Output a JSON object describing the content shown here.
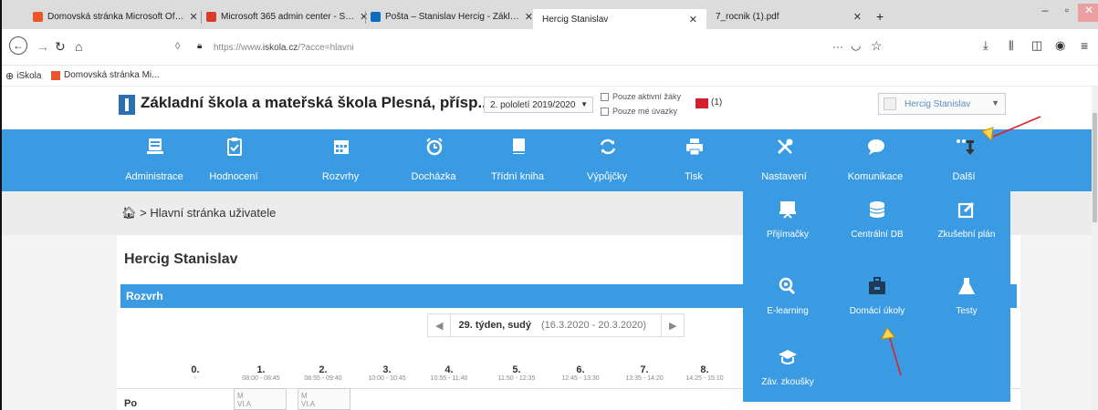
{
  "browser": {
    "tabs": [
      {
        "label": "Domovská stránka Microsoft Of…",
        "close": "✕",
        "color": "#e8562a"
      },
      {
        "label": "Microsoft 365 admin center - S…",
        "close": "✕",
        "color": "#d73b2a"
      },
      {
        "label": "Pošta – Stanislav Hercig - Zákl…",
        "close": "✕",
        "color": "#0f6cbd"
      },
      {
        "label": "Hercig Stanislav",
        "close": "✕",
        "color": "#ffffff"
      },
      {
        "label": "7_rocnik (1).pdf",
        "close": "✕",
        "color": "#dcdcdc"
      }
    ],
    "new_tab": "+",
    "url_prefix": "https://www.",
    "url_domain": "iskola.cz",
    "url_rest": "/?acce=hlavni",
    "page_actions": "···",
    "bookmarks": [
      {
        "label": "iSkola"
      },
      {
        "label": "Domovská stránka Mi..."
      }
    ]
  },
  "app": {
    "school_name": "Základní škola a mateřská škola Plesná, přísp...",
    "period": "2. pololetí 2019/2020",
    "filter_active": "Pouze aktivní žáky",
    "filter_mine": "Pouze mé úvazky",
    "mail_count": "(1)",
    "user": "Hercig Stanislav"
  },
  "menu": [
    {
      "label": "Administrace",
      "icon": "monitor-icon"
    },
    {
      "label": "Hodnocení",
      "icon": "clipboard-check-icon"
    },
    {
      "label": "Rozvrhy",
      "icon": "calendar-icon"
    },
    {
      "label": "Docházka",
      "icon": "alarm-clock-icon"
    },
    {
      "label": "Třídní kniha",
      "icon": "book-icon"
    },
    {
      "label": "Výpůjčky",
      "icon": "refresh-icon"
    },
    {
      "label": "Tisk",
      "icon": "printer-icon"
    },
    {
      "label": "Nastavení",
      "icon": "tools-icon"
    },
    {
      "label": "Komunikace",
      "icon": "chat-icon"
    },
    {
      "label": "Další",
      "icon": "more-icon"
    }
  ],
  "breadcrumb": "> Hlavní stránka uživatele",
  "user_heading": "Hercig Stanislav",
  "schedule": {
    "header": "Rozvrh",
    "week_label": "29. týden, sudý",
    "week_dates": "(16.3.2020 - 20.3.2020)",
    "prev": "◀",
    "next": "▶",
    "hours": [
      {
        "n": "0.",
        "t": "-"
      },
      {
        "n": "1.",
        "t": "08:00 - 08:45"
      },
      {
        "n": "2.",
        "t": "08:55 - 09:40"
      },
      {
        "n": "3.",
        "t": "10:00 - 10:45"
      },
      {
        "n": "4.",
        "t": "10:55 - 11:40"
      },
      {
        "n": "5.",
        "t": "11:50 - 12:35"
      },
      {
        "n": "6.",
        "t": "12:45 - 13:30"
      },
      {
        "n": "7.",
        "t": "13:35 - 14:20"
      },
      {
        "n": "8.",
        "t": "14:25 - 15:10"
      }
    ],
    "day": "Po",
    "cells": [
      {
        "line1": "M",
        "line2": "VI.A"
      },
      {
        "line1": "M",
        "line2": "VI.A"
      }
    ]
  },
  "dropdown": [
    {
      "label": "Přijímačky",
      "icon": "presentation-icon"
    },
    {
      "label": "Centrální DB",
      "icon": "database-icon"
    },
    {
      "label": "Zkušební plán",
      "icon": "edit-icon"
    },
    {
      "label": "E-learning",
      "icon": "elearning-icon"
    },
    {
      "label": "Domácí úkoly",
      "icon": "briefcase-icon"
    },
    {
      "label": "Testy",
      "icon": "flask-icon"
    },
    {
      "label": "Záv. zkoušky",
      "icon": "graduation-cap-icon"
    }
  ],
  "colors": {
    "menu_blue": "#3a9be3",
    "annotation": "#e0202a"
  }
}
